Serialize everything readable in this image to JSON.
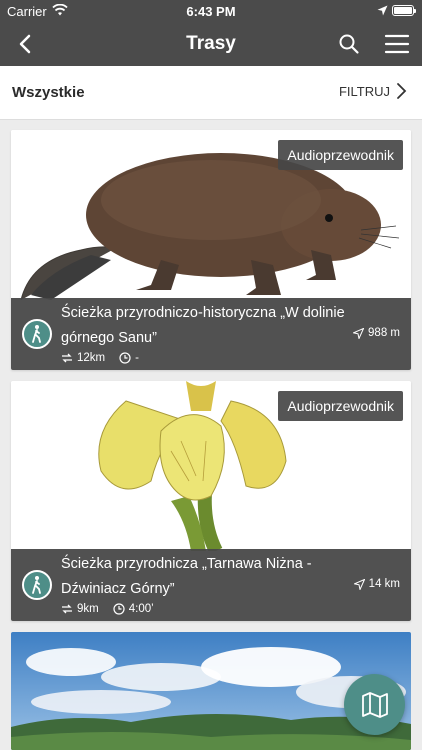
{
  "status_bar": {
    "carrier": "Carrier",
    "time": "6:43 PM"
  },
  "nav": {
    "title": "Trasy"
  },
  "filter_bar": {
    "all_label": "Wszystkie",
    "filter_label": "FILTRUJ"
  },
  "routes": [
    {
      "badge": "Audioprzewodnik",
      "title": "Ścieżka przyrodniczo-historyczna „W dolinie górnego Sanu”",
      "distance_to": "988 m",
      "length": "12km",
      "duration": "-",
      "image": "beaver"
    },
    {
      "badge": "Audioprzewodnik",
      "title": "Ścieżka przyrodnicza „Tarnawa Niżna - Dźwiniacz Górny”",
      "distance_to": "14 km",
      "length": "9km",
      "duration": "4:00’",
      "image": "yellow-iris"
    },
    {
      "image": "mountain-landscape"
    }
  ],
  "colors": {
    "header": "#4b4b4b",
    "accent": "#4e8e88"
  },
  "icons": [
    "back-icon",
    "search-icon",
    "menu-icon",
    "chevron-right-icon",
    "hiker-icon",
    "navigation-arrow-icon",
    "route-icon",
    "clock-icon",
    "map-icon"
  ]
}
